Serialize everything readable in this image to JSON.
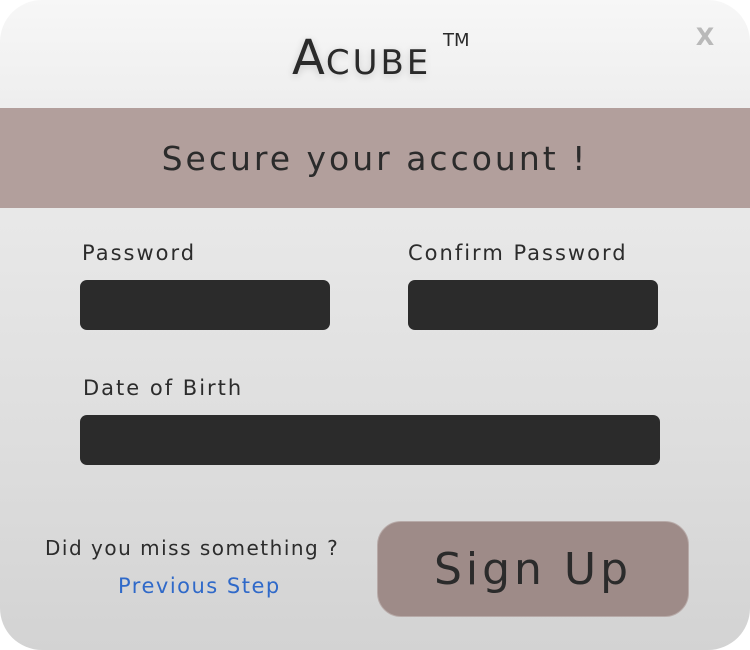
{
  "header": {
    "brand_first": "A",
    "brand_rest": "cube",
    "trademark": "TM",
    "close_label": "X"
  },
  "banner": {
    "title": "Secure your account !"
  },
  "form": {
    "password_label": "Password",
    "password_value": "",
    "confirm_password_label": "Confirm Password",
    "confirm_password_value": "",
    "dob_label": "Date of Birth",
    "dob_value": ""
  },
  "footer": {
    "hint": "Did you miss something ?",
    "previous_step": "Previous Step",
    "signup_label": "Sign Up"
  },
  "colors": {
    "banner": "#b29f9c",
    "field_bg": "#2b2b2b",
    "link": "#2f69c9",
    "signup_bg": "#9e8b88"
  }
}
